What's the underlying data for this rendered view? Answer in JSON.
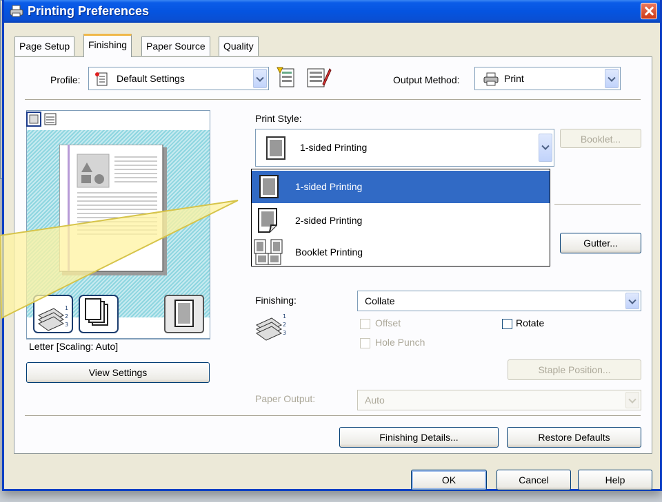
{
  "window": {
    "title": "Printing Preferences"
  },
  "tabs": [
    {
      "label": "Page Setup"
    },
    {
      "label": "Finishing",
      "active": true
    },
    {
      "label": "Paper Source"
    },
    {
      "label": "Quality"
    }
  ],
  "profile": {
    "label": "Profile:",
    "value": "Default Settings"
  },
  "output_method": {
    "label": "Output Method:",
    "value": "Print"
  },
  "preview": {
    "paper_caption": "Letter [Scaling: Auto]",
    "view_settings": "View Settings"
  },
  "print_style": {
    "label": "Print Style:",
    "value": "1-sided Printing",
    "booklet_button": "Booklet...",
    "options": [
      "1-sided Printing",
      "2-sided Printing",
      "Booklet Printing"
    ],
    "selected_option": "1-sided Printing"
  },
  "gutter_button": "Gutter...",
  "finishing": {
    "label": "Finishing:",
    "value": "Collate",
    "offset": "Offset",
    "rotate": "Rotate",
    "hole_punch": "Hole Punch",
    "staple_position": "Staple Position..."
  },
  "paper_output": {
    "label": "Paper Output:",
    "value": "Auto"
  },
  "buttons": {
    "finishing_details": "Finishing Details...",
    "restore_defaults": "Restore Defaults",
    "ok": "OK",
    "cancel": "Cancel",
    "help": "Help"
  },
  "colors": {
    "title_bar": "#0554e0",
    "selection": "#316ac5",
    "tab_highlight": "#f0b84a",
    "callout": "#fff3a0"
  }
}
